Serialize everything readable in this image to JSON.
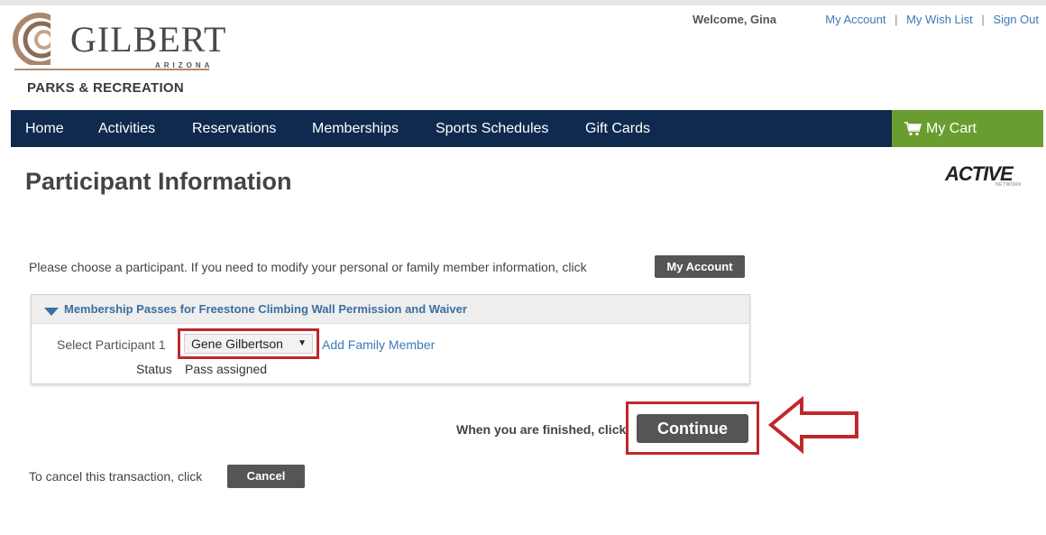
{
  "header": {
    "logo": {
      "name": "GILBERT",
      "state": "ARIZONA",
      "department": "PARKS & RECREATION"
    },
    "welcome": "Welcome, Gina",
    "links": {
      "my_account": "My Account",
      "my_wish_list": "My Wish List",
      "sign_out": "Sign Out",
      "separator": "|"
    }
  },
  "nav": {
    "items": [
      "Home",
      "Activities",
      "Reservations",
      "Memberships",
      "Sports Schedules",
      "Gift Cards"
    ],
    "cart_label": "My Cart"
  },
  "page": {
    "title": "Participant Information",
    "brand": "ACTIVE",
    "brand_sub": "NETWORK",
    "instruction": "Please choose a participant. If you need to modify your personal or family member information, click",
    "my_account_button": "My Account"
  },
  "panel": {
    "title": "Membership Passes for Freestone Climbing Wall Permission and Waiver",
    "select_label": "Select Participant 1",
    "selected_participant": "Gene Gilbertson",
    "add_family_member": "Add Family Member",
    "status_label": "Status",
    "status_value": "Pass assigned"
  },
  "finish": {
    "text": "When you are finished, click",
    "continue_button": "Continue"
  },
  "cancel": {
    "text": "To cancel this transaction, click",
    "button": "Cancel"
  },
  "colors": {
    "nav_background": "#0f2a4e",
    "cart_background": "#6a9d2f",
    "button_dark": "#555555",
    "highlight_red": "#c0272d",
    "link_blue": "#3b7ab5"
  },
  "icons": {
    "logo": "gilbert-swirl-icon",
    "cart": "shopping-cart-icon",
    "expand": "triangle-down-icon",
    "dropdown": "caret-down-icon",
    "annotation": "arrow-left-icon"
  }
}
